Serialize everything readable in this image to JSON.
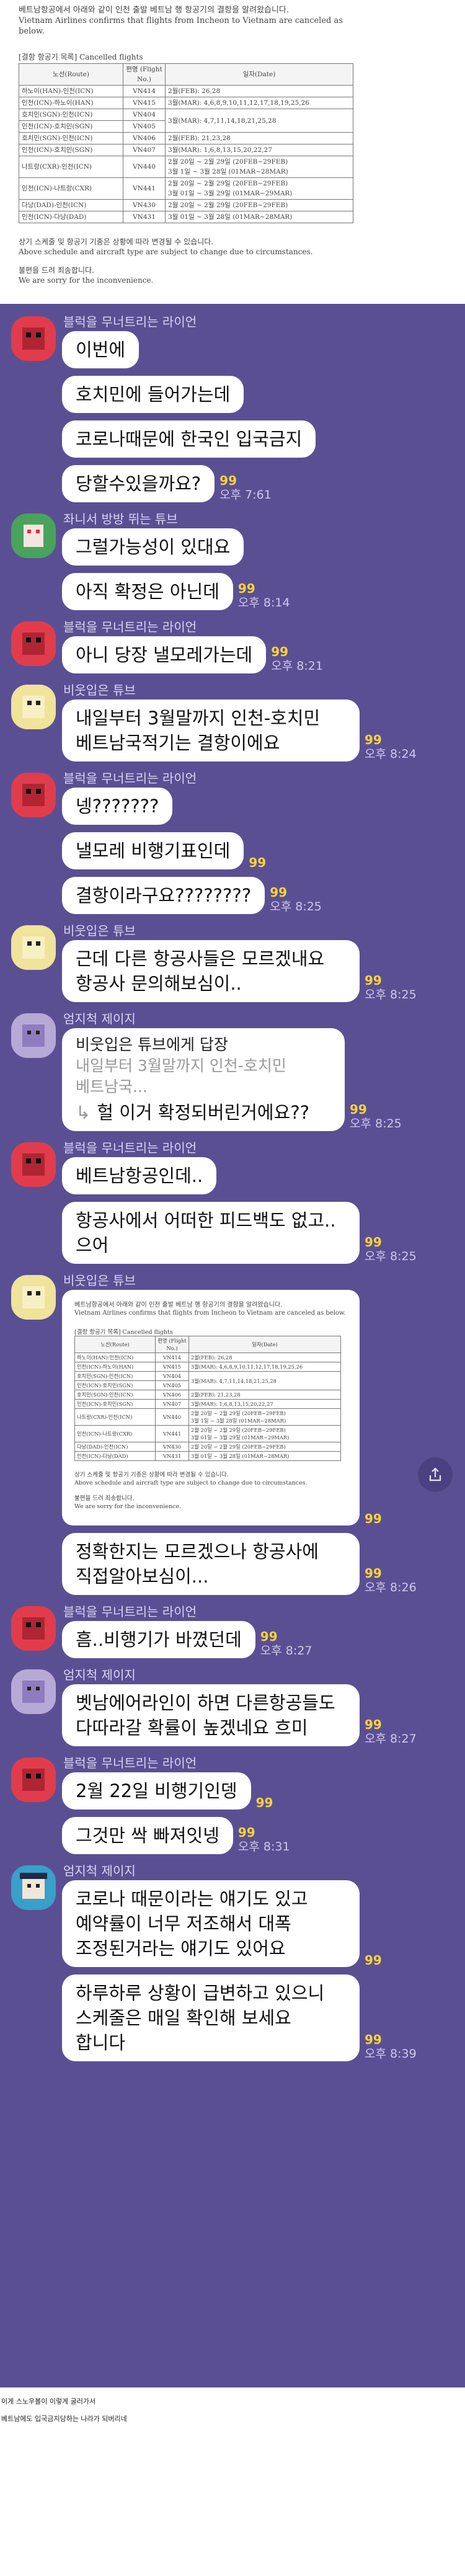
{
  "notice": {
    "intro_ko": "베트남항공에서 아래와 같이 인천 출발 베트남 행 항공기의 결항을 알려왔습니다.",
    "intro_en": "Vietnam Airlines confirms that flights from Incheon to Vietnam are canceled as below.",
    "table_caption": "[결항 항공기 목록] Cancelled flights",
    "headers": [
      "노선(Route)",
      "편명 (Flight No.)",
      "일자(Date)"
    ],
    "rows": [
      {
        "route": "하노이(HAN)-인천(ICN)",
        "flight": "VN414",
        "dates": [
          "2월(FEB): 26,28"
        ]
      },
      {
        "route": "인천(ICN)-하노이(HAN)",
        "flight": "VN415",
        "dates": [
          "3월(MAR): 4,6,8,9,10,11,12,17,18,19,25,26"
        ]
      },
      {
        "route": "호치민(SGN)-인천(ICN)",
        "flight": "VN404",
        "dates": [
          ""
        ]
      },
      {
        "route": "인천(ICN)-호치민(SGN)",
        "flight": "VN405",
        "dates": [
          "3월(MAR): 4,7,11,14,18,21,25,28"
        ]
      },
      {
        "route": "호치민(SGN)-인천(ICN)",
        "flight": "VN406",
        "dates": [
          "2월(FEB): 21,23,28"
        ]
      },
      {
        "route": "인천(ICN)-호치민(SGN)",
        "flight": "VN407",
        "dates": [
          "3월(MAR): 1,6,8,13,15,20,22,27"
        ]
      },
      {
        "route": "나트랑(CXR)-인천(ICN)",
        "flight": "VN440",
        "dates": [
          "2월 20일 ~ 2월 29일 (20FEB~29FEB)",
          "3월 1일 ~ 3월 28일 (01MAR~28MAR)"
        ]
      },
      {
        "route": "인천(ICN)-나트랑(CXR)",
        "flight": "VN441",
        "dates": [
          "2월 20일 ~ 2월 29일 (20FEB~29FEB)",
          "3월 01일 ~ 3월 29일 (01MAR~29MAR)"
        ]
      },
      {
        "route": "다낭(DAD)-인천(ICN)",
        "flight": "VN430",
        "dates": [
          "2월 20일 ~ 2월 29일 (20FEB~29FEB)"
        ]
      },
      {
        "route": "인천(ICN)-다낭(DAD)",
        "flight": "VN431",
        "dates": [
          "3월 01일 ~ 3월 28일 (01MAR~28MAR)"
        ]
      }
    ],
    "foot_ko": "상기 스케줄 및 항공기 기종은 상황에 따라 변경될 수 있습니다.",
    "foot_en": "Above schedule and aircraft type are subject to change due to circumstances.",
    "sorry_ko": "불편을 드려 죄송합니다.",
    "sorry_en": "We are sorry for the inconvenience."
  },
  "senders": {
    "a": "블럭을 무너트리는 라이언",
    "b": "좌니서 방방 뛰는 튜브",
    "c": "비웃입은 튜브",
    "d": "엄지척 제이지"
  },
  "messages": {
    "m1": "이번에",
    "m2": "호치민에 들어가는데",
    "m3": "코로나때문에 한국인 입국금지",
    "m4": "당할수있을까요?",
    "m5": "그럴가능성이 있대요",
    "m6": "아직 확정은 아닌데",
    "m7": "아니 당장 낼모레가는데",
    "m8": "내일부터 3월말까지 인천-호치민 베트남국적기는 결항이에요",
    "m9": "넹???????",
    "m10": "낼모레 비행기표인데",
    "m11": "결항이라구요????????",
    "m12": "근데 다른 항공사들은 모르겠내요 항공사 문의해보심이..",
    "m13_quote_title": "비웃입은 튜브에게 답장",
    "m13_quote_text": "내일부터 3월말까지 인천-호치민 베트남국...",
    "m13_body": "헐 이거 확정되버린거에요??",
    "m14": "베트남항공인데..",
    "m15": "항공사에서 어떠한 피드백도 없고..으어",
    "m16": "정확한지는 모르겠으나 항공사에 직접알아보심이...",
    "m17": "흠..비행기가 바꼈던데",
    "m18": "벳남에어라인이 하면 다른항공들도 다따라갈 확률이 높겠네요 흐미",
    "m19": "2월 22일 비행기인뎅",
    "m20": "그것만 싹 빠져잇넹",
    "m21": "코로나 때문이라는 얘기도 있고 예약률이 너무 저조해서 대폭 조정된거라는 얘기도 있어요",
    "m22": "하루하루 상황이 급변하고 있으니 스케줄은 매일 확인해 보세요 합니다"
  },
  "unread": "99",
  "times": {
    "t1": "오후 7:61",
    "t2": "오후 8:14",
    "t3": "오후 8:21",
    "t4": "오후 8:24",
    "t5": "오후 8:25",
    "t6": "오후 8:25",
    "t7": "오후 8:25",
    "t8": "오후 8:25",
    "t9": "오후 8:26",
    "t10": "오후 8:27",
    "t11": "오후 8:27",
    "t12": "오후 8:31",
    "t13": "오후 8:39"
  },
  "bottom": {
    "line1": "이게 스노우볼이 이렇게 굴러가서",
    "line2": "베트남에도 입국금지당하는 나라가 되버리네"
  },
  "colors": {
    "chat_bg": "#5b4f94",
    "unread": "#f5d33a"
  }
}
